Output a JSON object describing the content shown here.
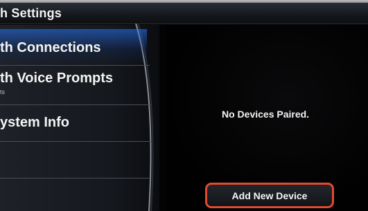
{
  "header": {
    "title": "h Settings"
  },
  "menu": {
    "items": [
      {
        "label": "th Connections",
        "sub": ""
      },
      {
        "label": "th Voice Prompts",
        "sub": "ts"
      },
      {
        "label": "ystem Info",
        "sub": ""
      }
    ]
  },
  "content": {
    "status": "No Devices Paired.",
    "add_device_label": "Add New Device"
  },
  "colors": {
    "highlight": "#e44a2f",
    "selection": "#2878ff"
  }
}
